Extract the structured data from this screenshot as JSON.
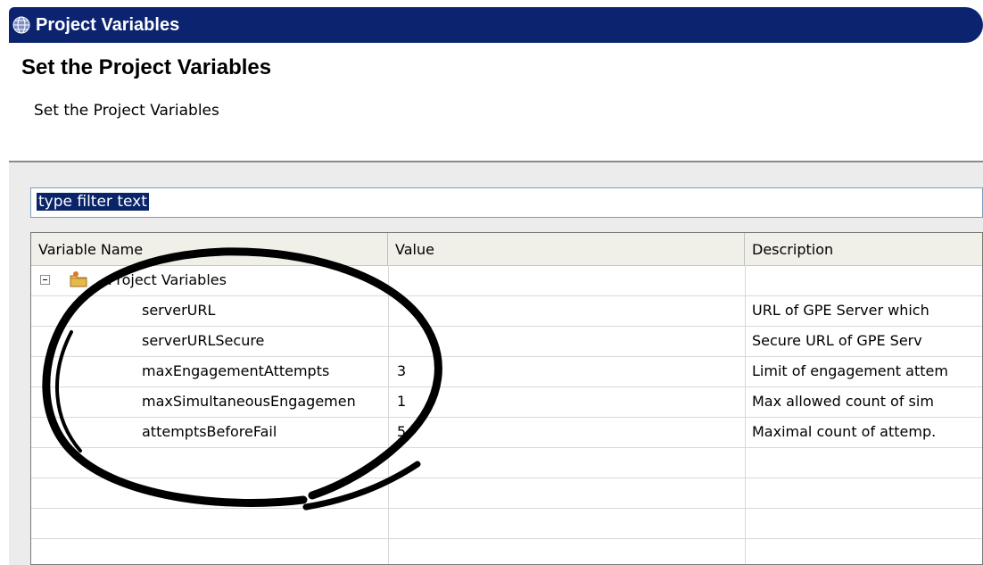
{
  "window": {
    "title": "Project Variables"
  },
  "header": {
    "title": "Set the Project Variables",
    "subtitle": "Set the Project Variables"
  },
  "filter": {
    "value": "type filter text"
  },
  "table": {
    "columns": [
      "Variable Name",
      "Value",
      "Description"
    ],
    "root": {
      "label": "Project Variables"
    },
    "rows": [
      {
        "name": "serverURL",
        "value": "",
        "description": "URL of GPE Server which"
      },
      {
        "name": "serverURLSecure",
        "value": "",
        "description": "Secure URL of GPE Serv"
      },
      {
        "name": "maxEngagementAttempts",
        "value": "3",
        "description": "Limit of engagement attem"
      },
      {
        "name": "maxSimultaneousEngagemen",
        "value": "1",
        "description": "Max allowed count of sim"
      },
      {
        "name": "attemptsBeforeFail",
        "value": "5",
        "description": "Maximal count of attemp."
      }
    ]
  },
  "colors": {
    "titlebar": "#0c2470",
    "selection": "#0a246a",
    "annotation": "#000000"
  },
  "icons": {
    "window": "globe-icon",
    "tree_toggle": "collapse-icon",
    "root": "folder-icon"
  }
}
